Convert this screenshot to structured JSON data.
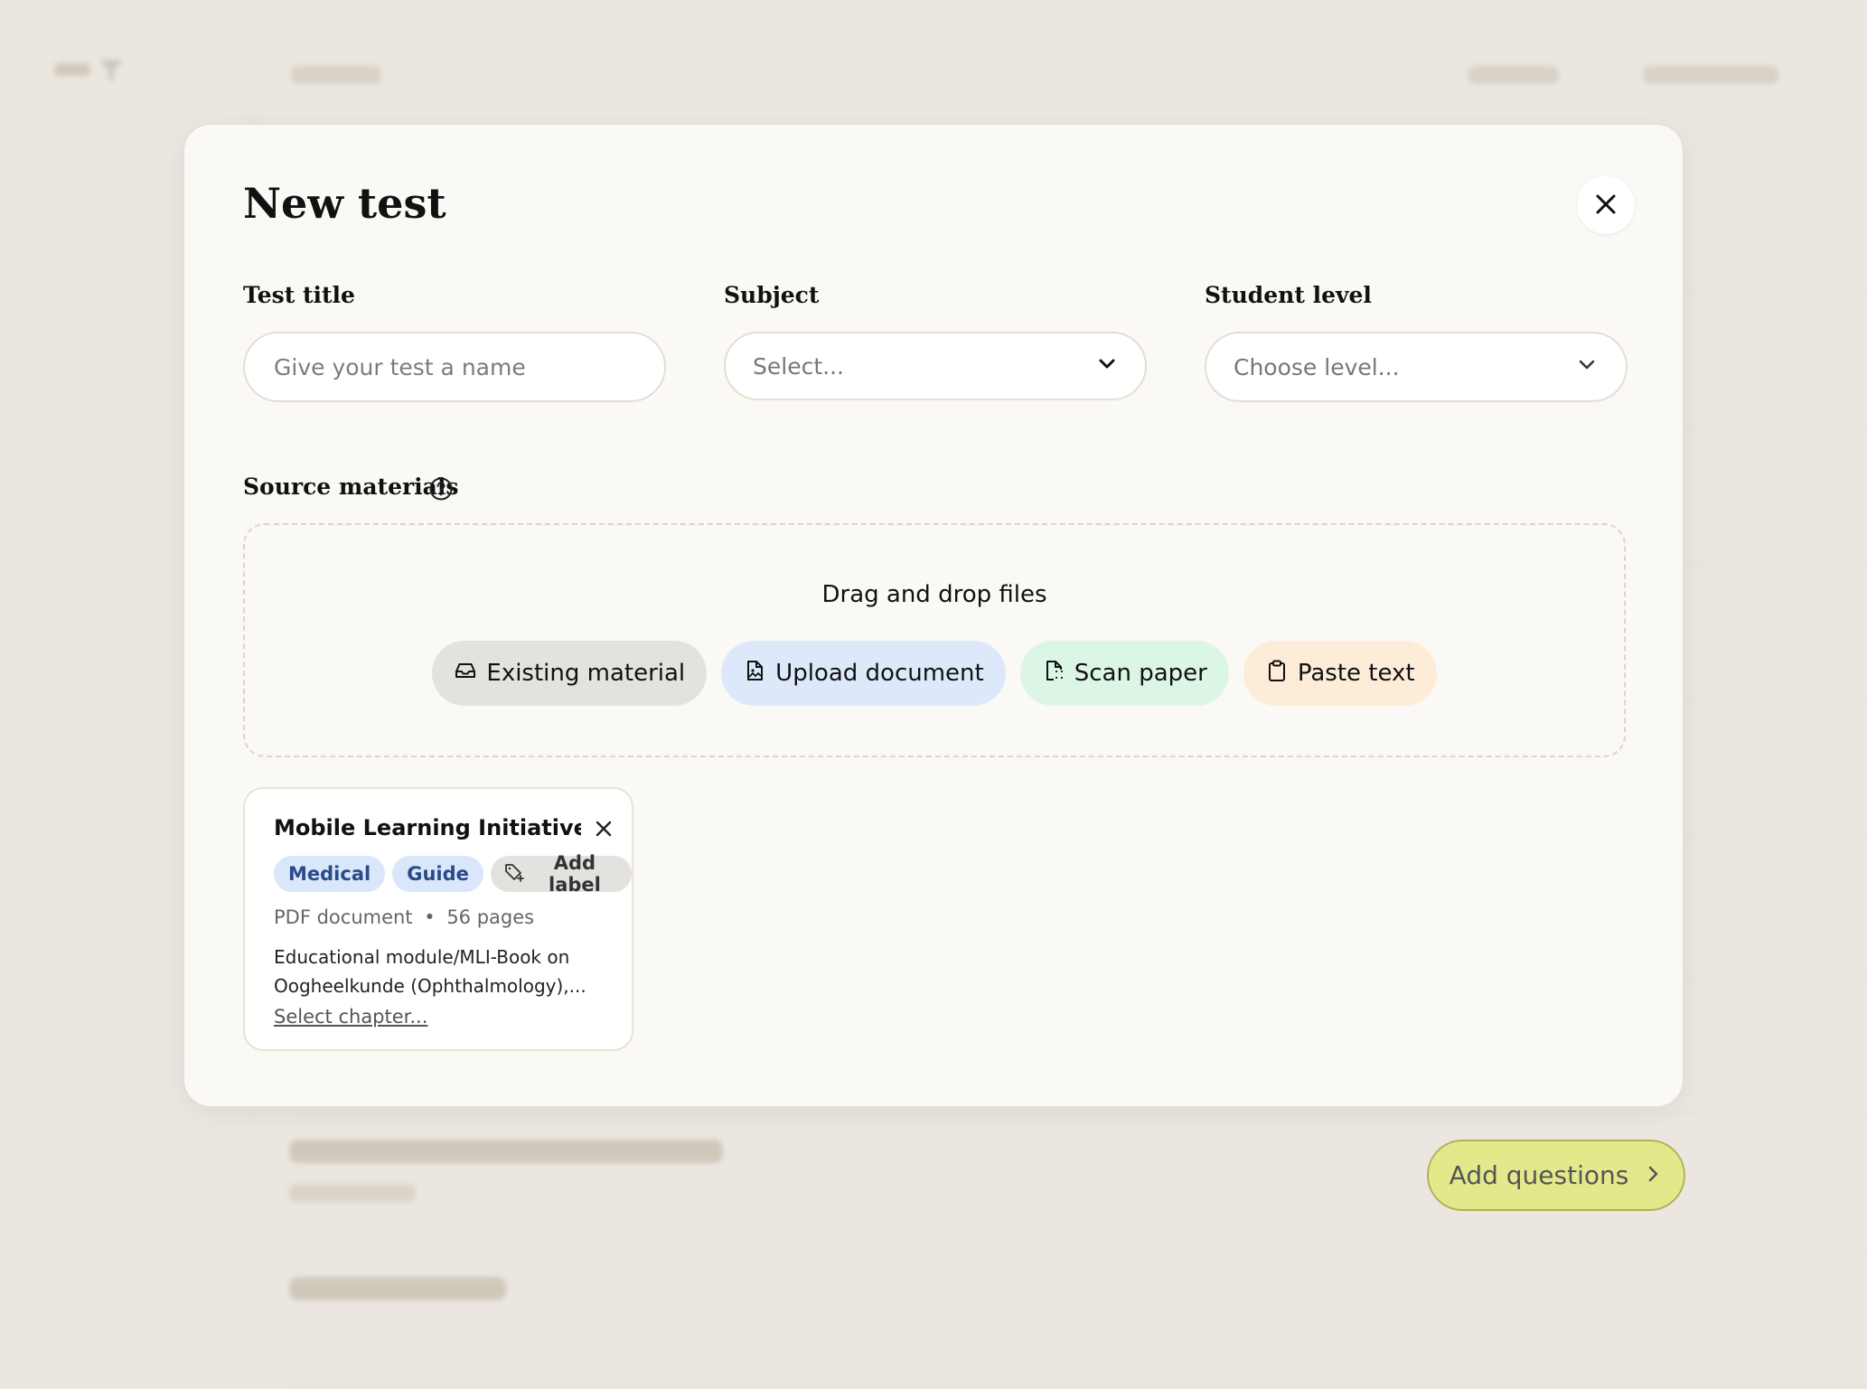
{
  "modal": {
    "title": "New test",
    "fields": {
      "test_title": {
        "label": "Test title",
        "placeholder": "Give your test a name"
      },
      "subject": {
        "label": "Subject",
        "value": "Select..."
      },
      "student_level": {
        "label": "Student level",
        "value": "Choose level..."
      }
    },
    "source_materials": {
      "label": "Source materials",
      "dropzone_text": "Drag and drop files",
      "buttons": {
        "existing": "Existing material",
        "upload": "Upload document",
        "scan": "Scan paper",
        "paste": "Paste text"
      }
    },
    "material_card": {
      "title": "Mobile Learning Initiative ...",
      "tags": [
        "Medical",
        "Guide"
      ],
      "add_label": "Add label",
      "type": "PDF document",
      "separator": "•",
      "pages": "56 pages",
      "description_line1": "Educational module/MLI-Book on",
      "description_line2": "Oogheelkunde (Ophthalmology),...",
      "select_chapter": "Select chapter..."
    }
  },
  "cta": {
    "label": "Add questions"
  },
  "colors": {
    "accent": "#e3e98a",
    "blue_pill": "#dde9fb",
    "green_pill": "#dcf6e6",
    "peach_pill": "#fcecd8",
    "gray_pill": "#e4e2df"
  }
}
